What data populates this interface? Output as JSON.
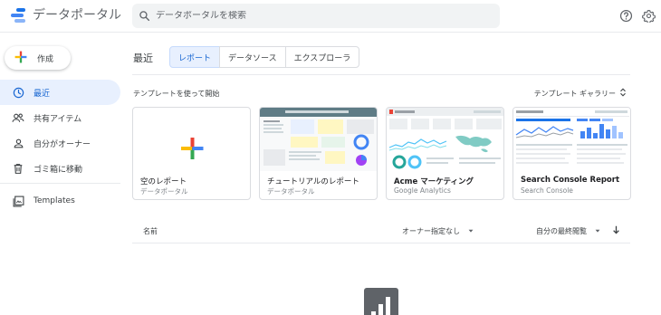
{
  "app": {
    "name": "データポータル"
  },
  "search": {
    "placeholder": "データポータルを検索"
  },
  "header_icons": [
    "help-icon",
    "settings-icon"
  ],
  "create_button": {
    "label": "作成"
  },
  "sidebar": {
    "items": [
      {
        "label": "最近",
        "icon": "clock-icon",
        "active": true
      },
      {
        "label": "共有アイテム",
        "icon": "shared-people-icon",
        "active": false
      },
      {
        "label": "自分がオーナー",
        "icon": "person-icon",
        "active": false
      },
      {
        "label": "ゴミ箱に移動",
        "icon": "trash-icon",
        "active": false
      }
    ],
    "templates_item": {
      "label": "Templates",
      "icon": "templates-icon"
    }
  },
  "main": {
    "section_title": "最近",
    "tabs": [
      {
        "label": "レポート",
        "active": true
      },
      {
        "label": "データソース",
        "active": false
      },
      {
        "label": "エクスプローラ",
        "active": false
      }
    ],
    "templates_heading": "テンプレートを使って開始",
    "gallery_label": "テンプレート ギャラリー",
    "cards": [
      {
        "title": "空のレポート",
        "subtitle": "データポータル"
      },
      {
        "title": "チュートリアルのレポート",
        "subtitle": "データポータル"
      },
      {
        "title": "Acme マーケティング",
        "subtitle": "Google Analytics"
      },
      {
        "title": "Search Console Report",
        "subtitle": "Search Console"
      }
    ],
    "list_header": {
      "name": "名前",
      "owner": "オーナー指定なし",
      "sort": "自分の最終閲覧"
    }
  },
  "colors": {
    "accent_blue": "#1a73e8",
    "active_bg": "#e8f0fe",
    "google_red": "#ea4335",
    "google_yellow": "#fbbc04",
    "google_green": "#34a853"
  }
}
